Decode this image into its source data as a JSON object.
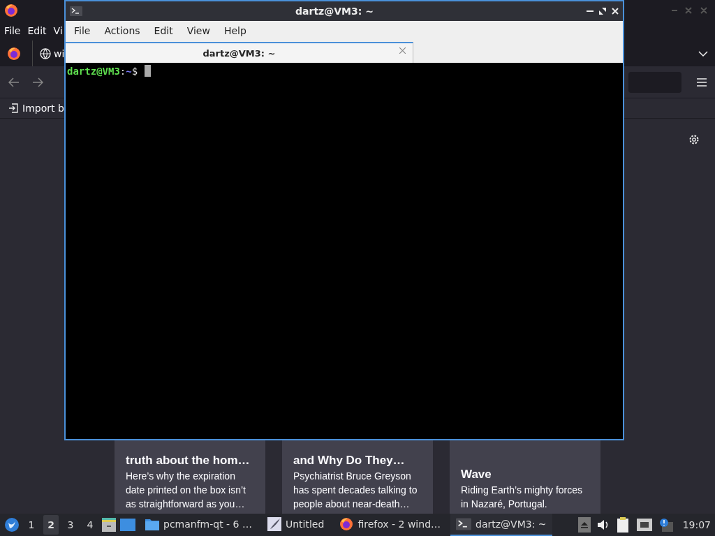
{
  "firefox_window": {
    "menu": [
      "File",
      "Edit",
      "Vi"
    ],
    "tab": {
      "title": "wi"
    },
    "bookmarks_toolbar": {
      "import_label": "Import b"
    },
    "stories": [
      {
        "title": "truth about the hom…",
        "excerpt": "Here’s why the expiration\ndate printed on the box isn’t\nas straightforward as you…"
      },
      {
        "title": "and Why Do They…",
        "excerpt": "Psychiatrist Bruce Greyson\nhas spent decades talking to\npeople about near-death…"
      },
      {
        "title": "Wave",
        "excerpt": "Riding Earth’s mighty forces\nin Nazaré, Portugal."
      }
    ]
  },
  "terminal_window": {
    "title": "dartz@VM3: ~",
    "menu": [
      "File",
      "Actions",
      "Edit",
      "View",
      "Help"
    ],
    "tabs": [
      {
        "title": "dartz@VM3: ~",
        "selected": true
      }
    ],
    "prompt": {
      "user_host": "dartz@VM3",
      "separator": ":",
      "path": "~",
      "symbol": "$"
    }
  },
  "taskbar": {
    "workspaces": [
      {
        "label": "1",
        "selected": false
      },
      {
        "label": "2",
        "selected": true
      },
      {
        "label": "3",
        "selected": false
      },
      {
        "label": "4",
        "selected": false
      }
    ],
    "tasks": [
      {
        "kind": "folder",
        "label": "pcmanfm-qt - 6 …",
        "active": false
      },
      {
        "kind": "document",
        "label": "Untitled",
        "active": false
      },
      {
        "kind": "firefox",
        "label": "firefox - 2 wind…",
        "active": false
      },
      {
        "kind": "terminal",
        "label": "dartz@VM3: ~",
        "active": true
      }
    ],
    "clock": "19:07"
  }
}
